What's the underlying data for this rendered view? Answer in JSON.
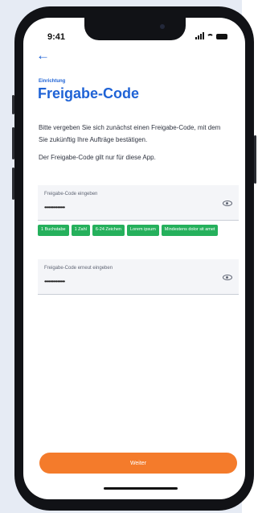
{
  "status_bar": {
    "time": "9:41"
  },
  "header": {
    "eyebrow": "Einrichtung",
    "title": "Freigabe-Code"
  },
  "content": {
    "description": "Bitte vergeben Sie sich zunächst einen Freigabe-Code, mit dem Sie zukünftig Ihre Aufträge bestätigen.",
    "note": "Der Freigabe-Code gilt nur für diese App."
  },
  "fields": {
    "code": {
      "label": "Freigabe-Code eingeben",
      "value": "••••••••••••••"
    },
    "confirm": {
      "label": "Freigabe-Code erneut eingeben",
      "value": "••••••••••••••"
    }
  },
  "requirements": [
    "1 Buchstabe",
    "1 Zahl",
    "6-24 Zeichen",
    "Lorem ipsum",
    "Mindestens dolor sit amet"
  ],
  "footer": {
    "primary_button": "Weiter"
  },
  "colors": {
    "accent": "#1f63d6",
    "success": "#25b05c",
    "cta": "#f47b2b"
  },
  "icons": {
    "back": "arrow-left-icon",
    "visibility": "eye-icon"
  }
}
